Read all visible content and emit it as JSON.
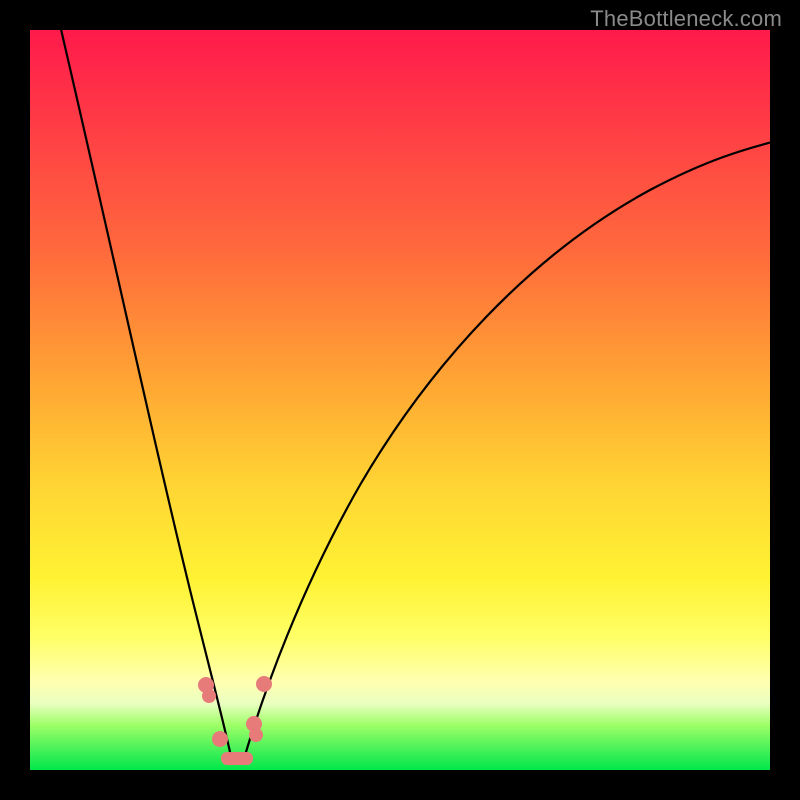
{
  "watermark": "TheBottleneck.com",
  "colors": {
    "frame_bg": "#000000",
    "gradient_top": "#ff1a4b",
    "gradient_mid": "#ffd633",
    "gradient_bottom": "#00e84a",
    "curve_stroke": "#000000",
    "marker_fill": "#e77b7a"
  },
  "chart_data": {
    "type": "line",
    "title": "",
    "xlabel": "",
    "ylabel": "",
    "xlim": [
      0,
      100
    ],
    "ylim": [
      0,
      100
    ],
    "grid": false,
    "legend": false,
    "note": "Values are approximate, read off pixel positions; y is 0 at bottom, 100 at top.",
    "series": [
      {
        "name": "left-branch",
        "x": [
          4,
          6,
          8,
          10,
          12,
          14,
          16,
          18,
          20,
          22,
          24,
          25,
          26,
          27
        ],
        "y": [
          100,
          90,
          80,
          70,
          60,
          50,
          40,
          31,
          23,
          15,
          8,
          5,
          3,
          1
        ]
      },
      {
        "name": "right-branch",
        "x": [
          29,
          30,
          32,
          34,
          37,
          41,
          46,
          52,
          59,
          67,
          76,
          86,
          96,
          100
        ],
        "y": [
          1,
          3,
          7,
          12,
          19,
          27,
          36,
          45,
          54,
          62,
          70,
          77,
          83,
          85
        ]
      }
    ],
    "markers": [
      {
        "name": "left-upper-dot",
        "x": 23.8,
        "y": 11.5
      },
      {
        "name": "left-upper-dot-2",
        "x": 24.2,
        "y": 10.0
      },
      {
        "name": "left-lower-dot",
        "x": 25.6,
        "y": 4.2
      },
      {
        "name": "right-upper-dot",
        "x": 31.6,
        "y": 11.6
      },
      {
        "name": "right-mid-dot",
        "x": 30.3,
        "y": 6.2
      },
      {
        "name": "right-mid-dot-2",
        "x": 30.6,
        "y": 4.8
      },
      {
        "name": "valley-cap-left",
        "x": 26.6,
        "y": 1.3
      },
      {
        "name": "valley-cap-right",
        "x": 29.0,
        "y": 1.3
      }
    ]
  }
}
